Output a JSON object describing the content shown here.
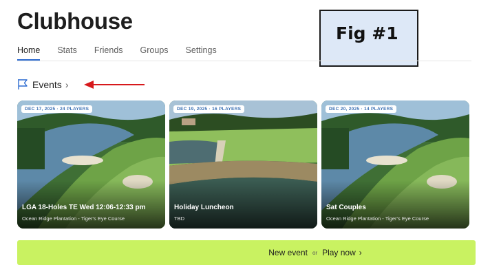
{
  "app": {
    "title": "Clubhouse"
  },
  "figure": {
    "label": "Fig #1"
  },
  "tabs": [
    {
      "label": "Home",
      "active": true
    },
    {
      "label": "Stats",
      "active": false
    },
    {
      "label": "Friends",
      "active": false
    },
    {
      "label": "Groups",
      "active": false
    },
    {
      "label": "Settings",
      "active": false
    }
  ],
  "events": {
    "label": "Events",
    "chevron": "›",
    "icon": "flag-icon"
  },
  "annotation": {
    "arrow_color": "#d7191c",
    "icon": "red-arrow-icon"
  },
  "cards": [
    {
      "badge": "DEC 17, 2025 · 24 PLAYERS",
      "title": "LGA 18-Holes TE Wed 12:06-12:33 pm",
      "subtitle": "Ocean Ridge Plantation - Tiger's Eye Course"
    },
    {
      "badge": "DEC 19, 2025 · 16 PLAYERS",
      "title": "Holiday Luncheon",
      "subtitle": "TBD"
    },
    {
      "badge": "DEC 20, 2025 · 14 PLAYERS",
      "title": "Sat Couples",
      "subtitle": "Ocean Ridge Plantation - Tiger's Eye Course"
    }
  ],
  "actions": {
    "new_event": "New event",
    "or": "or",
    "play_now": "Play now",
    "chevron": "›"
  },
  "colors": {
    "accent": "#2d6bd0",
    "action_bar": "#c9f261",
    "badge_text": "#3a6fb3"
  }
}
